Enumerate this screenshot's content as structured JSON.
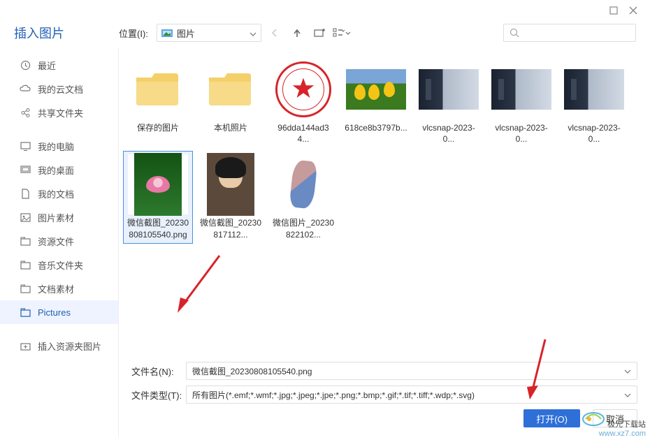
{
  "window": {
    "title": "插入图片"
  },
  "toolbar": {
    "location_label": "位置(I):",
    "location_value": "图片"
  },
  "sidebar": {
    "groups": [
      {
        "items": [
          {
            "icon": "clock-icon",
            "label": "最近"
          },
          {
            "icon": "cloud-icon",
            "label": "我的云文档"
          },
          {
            "icon": "share-icon",
            "label": "共享文件夹"
          }
        ]
      },
      {
        "items": [
          {
            "icon": "monitor-icon",
            "label": "我的电脑"
          },
          {
            "icon": "desktop-icon",
            "label": "我的桌面"
          },
          {
            "icon": "document-icon",
            "label": "我的文档"
          },
          {
            "icon": "image-icon",
            "label": "图片素材"
          },
          {
            "icon": "resource-icon",
            "label": "资源文件"
          },
          {
            "icon": "folder-icon",
            "label": "音乐文件夹"
          },
          {
            "icon": "doc-material-icon",
            "label": "文档素材"
          },
          {
            "icon": "pictures-icon",
            "label": "Pictures",
            "active": true
          }
        ]
      },
      {
        "items": [
          {
            "icon": "insert-resource-icon",
            "label": "插入资源夹图片"
          }
        ]
      }
    ]
  },
  "files": {
    "row1": [
      {
        "type": "folder",
        "label": "保存的图片"
      },
      {
        "type": "folder",
        "label": "本机照片"
      },
      {
        "type": "stamp",
        "label": "96dda144ad34..."
      },
      {
        "type": "flowers",
        "label": "618ce8b3797b..."
      },
      {
        "type": "movie",
        "label": "vlcsnap-2023-0..."
      },
      {
        "type": "movie",
        "label": "vlcsnap-2023-0..."
      },
      {
        "type": "movie",
        "label": "vlcsnap-2023-0..."
      }
    ],
    "row2": [
      {
        "type": "lotus",
        "label": "微信截图_20230808105540.png",
        "selected": true
      },
      {
        "type": "portrait",
        "label": "微信截图_2023081711​2..."
      },
      {
        "type": "art",
        "label": "微信图片_2023082210​2..."
      }
    ]
  },
  "footer": {
    "filename_label": "文件名(N):",
    "filename_value": "微信截图_20230808105540.png",
    "filetype_label": "文件类型(T):",
    "filetype_value": "所有图片(*.emf;*.wmf;*.jpg;*.jpeg;*.jpe;*.png;*.bmp;*.gif;*.tif;*.tiff;*.wdp;*.svg)",
    "open_btn": "打开(O)",
    "cancel_btn": "取消"
  },
  "watermark": {
    "line1": "极光下载站",
    "line2": "www.xz7.com"
  }
}
